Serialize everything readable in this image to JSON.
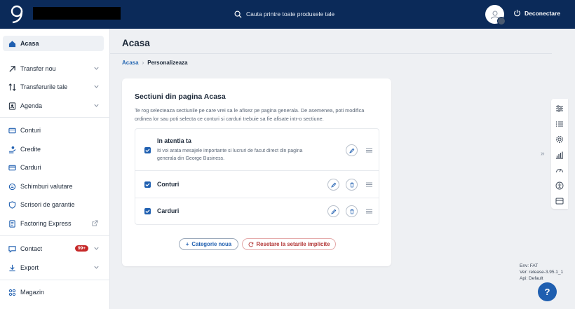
{
  "header": {
    "search_placeholder": "Cauta printre toate produsele tale",
    "logout_label": "Deconectare"
  },
  "sidebar": {
    "items": [
      {
        "label": "Acasa"
      },
      {
        "label": "Transfer nou"
      },
      {
        "label": "Transferurile tale"
      },
      {
        "label": "Agenda"
      },
      {
        "label": "Conturi"
      },
      {
        "label": "Credite"
      },
      {
        "label": "Carduri"
      },
      {
        "label": "Schimburi valutare"
      },
      {
        "label": "Scrisori de garantie"
      },
      {
        "label": "Factoring Express"
      },
      {
        "label": "Contact",
        "badge": "99+"
      },
      {
        "label": "Export"
      },
      {
        "label": "Magazin"
      }
    ]
  },
  "main": {
    "title": "Acasa",
    "breadcrumb": {
      "root": "Acasa",
      "current": "Personalizeaza"
    },
    "card": {
      "title": "Sectiuni din pagina Acasa",
      "description": "Te rog selecteaza sectiunile pe care vrei sa le afisez pe pagina generala. De asemenea, poti modifica ordinea lor sau poti selecta ce conturi si carduri trebuie sa fie afisate intr-o sectiune.",
      "sections": [
        {
          "title": "In atentia ta",
          "description": "Iti voi arata mesajele importante si lucruri de facut direct din pagina generala din George Business.",
          "checked": true
        },
        {
          "title": "Conturi",
          "checked": true
        },
        {
          "title": "Carduri",
          "checked": true
        }
      ],
      "add_category_label": "Categorie noua",
      "reset_label": "Resetare la setarile implicite"
    }
  },
  "env_info": {
    "env": "Env: FAT",
    "ver": "Ver: release-3.95.1_1",
    "api": "Api: Default"
  },
  "help_label": "?",
  "colors": {
    "topbar": "#0b2a59",
    "accent": "#1f5fb0",
    "danger": "#b13434",
    "badge": "#c62828"
  }
}
